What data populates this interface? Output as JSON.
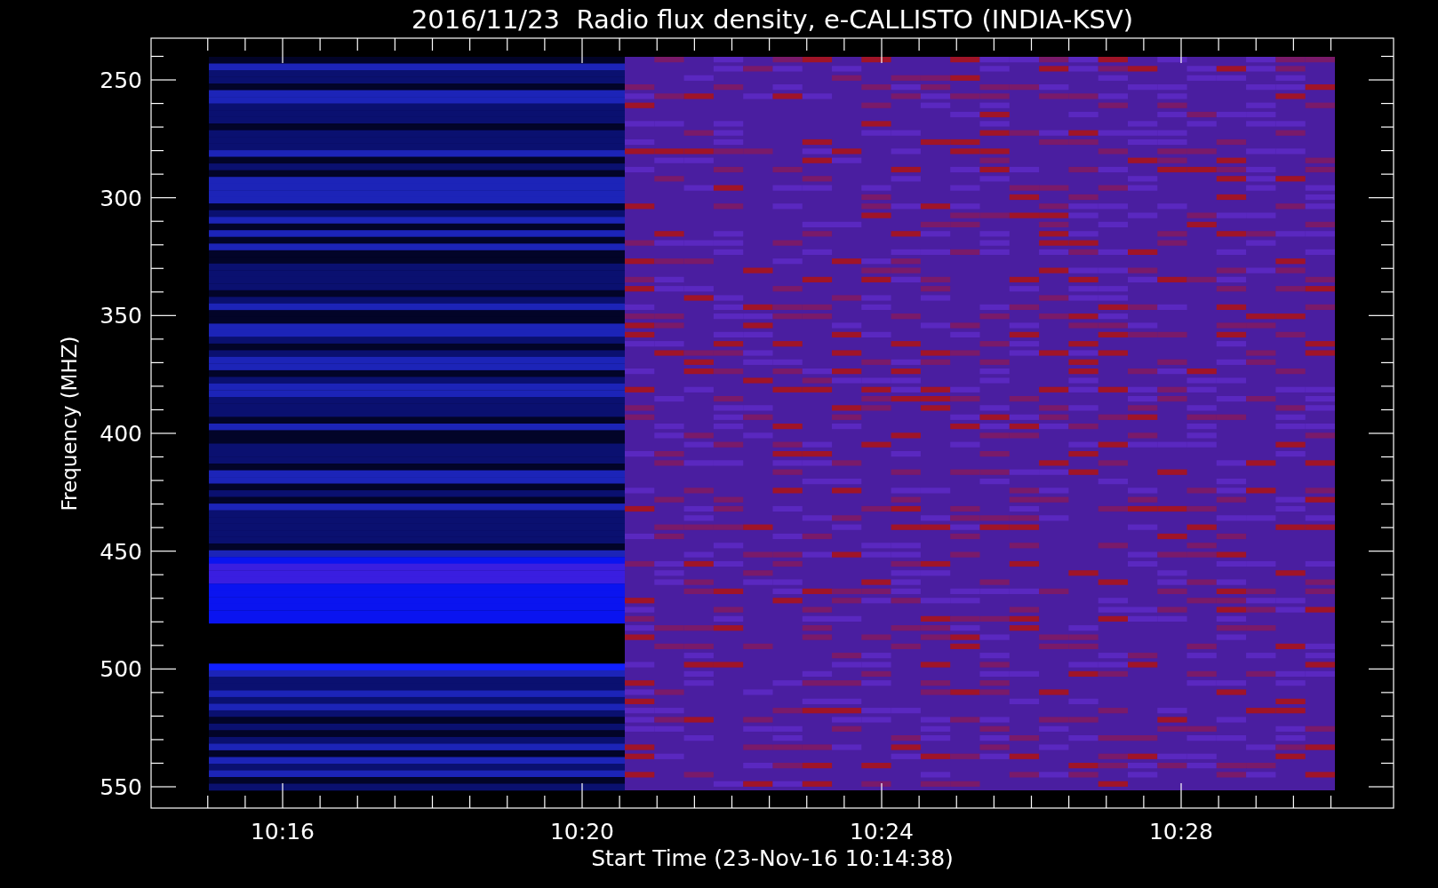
{
  "title": "2016/11/23  Radio flux density, e-CALLISTO (INDIA-KSV)",
  "y_axis": {
    "label": "Frequency (MHZ)",
    "ticks": [
      "250",
      "300",
      "350",
      "400",
      "450",
      "500",
      "550"
    ]
  },
  "x_axis": {
    "label": "Start Time (23-Nov-16 10:14:38)",
    "ticks": [
      "10:16",
      "10:20",
      "10:24",
      "10:28"
    ]
  }
}
